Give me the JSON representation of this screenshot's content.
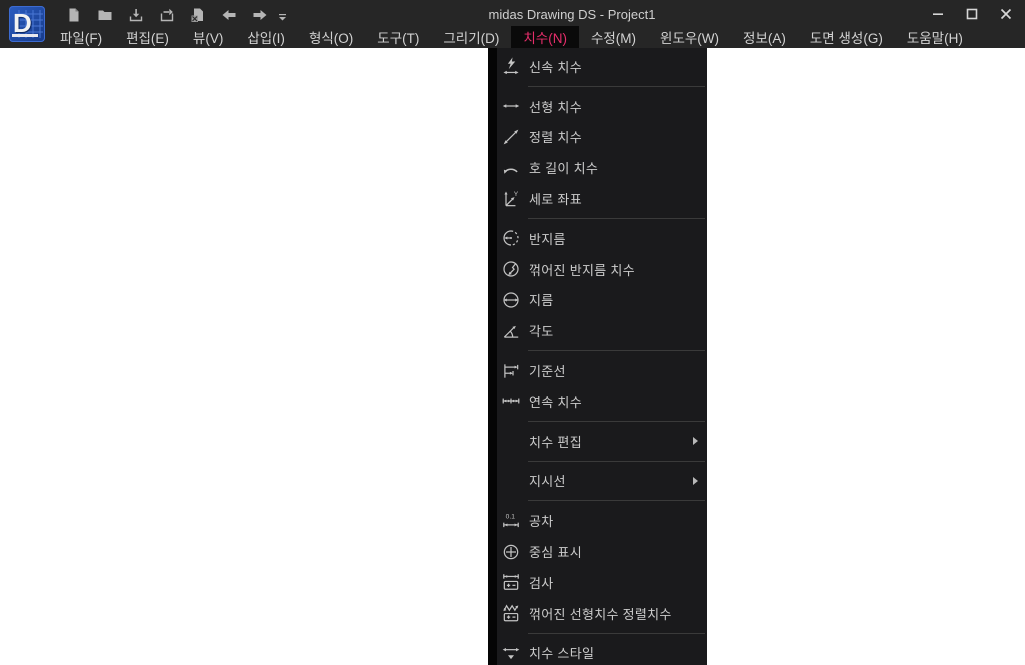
{
  "window": {
    "title": "midas Drawing DS - Project1",
    "app_name": "midas Drawing DS",
    "document_name": "Project1"
  },
  "quick_toolbar": {
    "buttons": [
      {
        "name": "new-document"
      },
      {
        "name": "open-folder"
      },
      {
        "name": "save"
      },
      {
        "name": "save-as"
      },
      {
        "name": "export-image"
      },
      {
        "name": "back"
      },
      {
        "name": "forward"
      }
    ],
    "overflow_button": {
      "name": "toolbar-overflow"
    }
  },
  "window_controls": [
    {
      "name": "minimize"
    },
    {
      "name": "maximize"
    },
    {
      "name": "close"
    }
  ],
  "menubar": {
    "items": [
      {
        "label": "파일(F)",
        "active": false
      },
      {
        "label": "편집(E)",
        "active": false
      },
      {
        "label": "뷰(V)",
        "active": false
      },
      {
        "label": "삽입(I)",
        "active": false
      },
      {
        "label": "형식(O)",
        "active": false
      },
      {
        "label": "도구(T)",
        "active": false
      },
      {
        "label": "그리기(D)",
        "active": false
      },
      {
        "label": "치수(N)",
        "active": true
      },
      {
        "label": "수정(M)",
        "active": false
      },
      {
        "label": "윈도우(W)",
        "active": false
      },
      {
        "label": "정보(A)",
        "active": false
      },
      {
        "label": "도면 생성(G)",
        "active": false
      },
      {
        "label": "도움말(H)",
        "active": false
      }
    ]
  },
  "dimension_menu": {
    "open_for": "치수(N)",
    "items": [
      {
        "label": "신속 치수",
        "icon": "quick-dimension",
        "has_submenu": false,
        "group": 1
      },
      {
        "label": "선형 치수",
        "icon": "linear-dimension",
        "has_submenu": false,
        "group": 2
      },
      {
        "label": "정렬 치수",
        "icon": "aligned-dimension",
        "has_submenu": false,
        "group": 2
      },
      {
        "label": "호 길이 치수",
        "icon": "arc-length-dimension",
        "has_submenu": false,
        "group": 2
      },
      {
        "label": "세로 좌표",
        "icon": "ordinate-dimension",
        "has_submenu": false,
        "group": 2
      },
      {
        "label": "반지름",
        "icon": "radius-dimension",
        "has_submenu": false,
        "group": 3
      },
      {
        "label": "꺾어진 반지름 치수",
        "icon": "jogged-radius-dimension",
        "has_submenu": false,
        "group": 3
      },
      {
        "label": "지름",
        "icon": "diameter-dimension",
        "has_submenu": false,
        "group": 3
      },
      {
        "label": "각도",
        "icon": "angle-dimension",
        "has_submenu": false,
        "group": 3
      },
      {
        "label": "기준선",
        "icon": "baseline-dimension",
        "has_submenu": false,
        "group": 4
      },
      {
        "label": "연속 치수",
        "icon": "continue-dimension",
        "has_submenu": false,
        "group": 4
      },
      {
        "label": "치수 편집",
        "icon": null,
        "has_submenu": true,
        "group": 5
      },
      {
        "label": "지시선",
        "icon": null,
        "has_submenu": true,
        "group": 6
      },
      {
        "label": "공차",
        "icon": "tolerance",
        "has_submenu": false,
        "group": 7
      },
      {
        "label": "중심 표시",
        "icon": "center-mark",
        "has_submenu": false,
        "group": 7
      },
      {
        "label": "검사",
        "icon": "inspection",
        "has_submenu": false,
        "group": 7
      },
      {
        "label": "꺾어진 선형치수 정렬치수",
        "icon": "jogged-linear-aligned",
        "has_submenu": false,
        "group": 7
      },
      {
        "label": "치수 스타일",
        "icon": "dimension-style",
        "has_submenu": false,
        "group": 8
      }
    ]
  },
  "colors": {
    "chrome_bg": "#262626",
    "dropdown_bg": "#1a1a1c",
    "active_item_bg": "#0a0a0a",
    "accent_pink": "#e62e6b",
    "menu_text": "#cccccc",
    "separator": "#3a3a3a",
    "canvas": "#ffffff",
    "app_icon_blue": "#2b5cc0"
  }
}
